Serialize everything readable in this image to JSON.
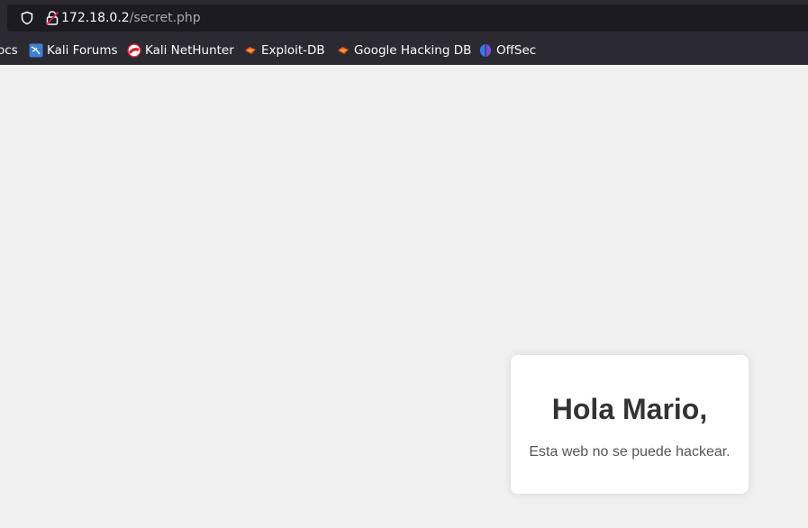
{
  "browser": {
    "url_host": "172.18.0.2",
    "url_path": "/secret.php",
    "bookmarks": [
      {
        "label": "ocs",
        "icon": "none"
      },
      {
        "label": "Kali Forums",
        "icon": "kali-forums-icon"
      },
      {
        "label": "Kali NetHunter",
        "icon": "kali-nethunter-icon"
      },
      {
        "label": "Exploit-DB",
        "icon": "exploit-db-icon"
      },
      {
        "label": "Google Hacking DB",
        "icon": "exploit-db-icon"
      },
      {
        "label": "OffSec",
        "icon": "offsec-icon"
      }
    ]
  },
  "card": {
    "title": "Hola Mario,",
    "message": "Esta web no se puede hackear."
  },
  "colors": {
    "chrome_bg": "#2b2a33",
    "urlbar_bg": "#1c1b22",
    "page_bg": "#f0f0f0",
    "card_bg": "#ffffff",
    "title": "#333333",
    "text": "#555555"
  }
}
